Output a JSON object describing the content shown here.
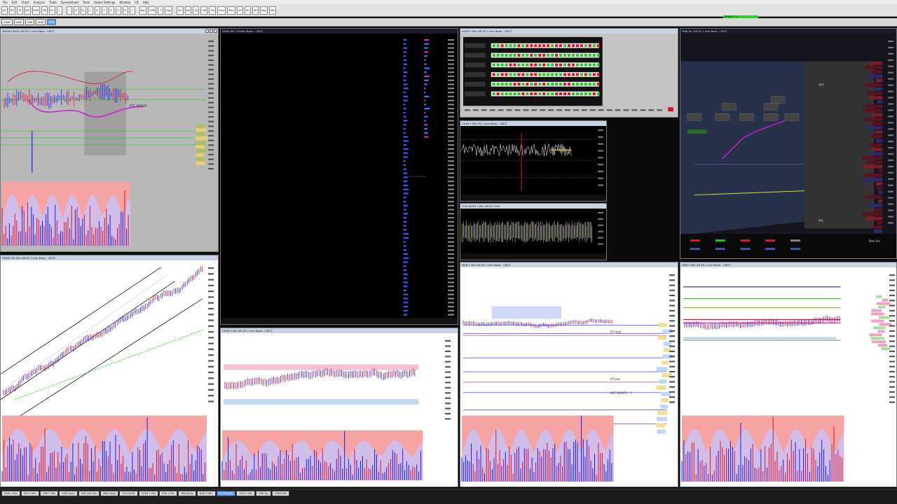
{
  "menu": [
    "File",
    "Edit",
    "Chart",
    "Analysis",
    "Trade",
    "Spreadsheet",
    "Tools",
    "Global Settings",
    "Window",
    "CB",
    "Help"
  ],
  "toolbar_buttons": [
    "SC",
    "DC",
    "TS",
    "CB",
    "DTB",
    "FB",
    "SO",
    "+",
    "-",
    "A",
    "B",
    "C",
    "D",
    "E",
    "F",
    "G",
    "H",
    "I",
    "Rpt",
    "CVW",
    "T",
    "Log",
    "3m",
    "5m",
    "1D",
    "1W",
    "1M",
    "15m",
    "30m",
    "1H",
    "2H",
    "4H",
    "Day",
    "Min"
  ],
  "subtabs": [
    "VSX6",
    "VIX6",
    "YM6",
    "NQ6",
    "ES6"
  ],
  "active_subtab": "ES6",
  "windows": [
    {
      "id": "w1",
      "title": "SNM#3 Daily  #8  ES 1-min Base - CBOT"
    },
    {
      "id": "w2",
      "title": "VSX6 #8 1-Profile  Base - CBOT"
    },
    {
      "id": "w3",
      "title": "VSX6 5 Min  #6  ES 1-min Base - CBOT"
    },
    {
      "id": "w4",
      "title": "YM6 Qtr  #8  ES 1-min Base - CBOT"
    },
    {
      "id": "w5",
      "title": "VXX6 5 Min  ES 1-min Base - CBOT"
    },
    {
      "id": "w6",
      "title": "TICK NYSE  1 Min  #8  ES  TICK"
    },
    {
      "id": "w7",
      "title": "VSX6 200 Min  #8  ES 1-min Base - CBOT"
    },
    {
      "id": "w8",
      "title": "VSX6 5 Min  #8  ES 1-min Base - CBOT"
    },
    {
      "id": "w9",
      "title": "NQ6 1 Min  #8  ES 1-min Base - CBOT"
    },
    {
      "id": "w10",
      "title": "YM6 5 Min  #8  ES 1-min Base - CBOT"
    }
  ],
  "levels": {
    "poc": "POC 440448",
    "vp_high": "VP High",
    "vp_low": "VP Low",
    "poc_month": "POC MONTH - 1",
    "val": "VAL",
    "vah": "VAH",
    "total_vol": "Total Vol"
  },
  "status": "6546 0 7 1",
  "taskbar": [
    "NQ6 1 Min",
    "ES6 5 Min",
    "YM6 5 Min",
    "VIX6 Daily",
    "ES6 200 Min",
    "NQ6 Daily",
    "TICK NYSE",
    "VSX6 1 Min",
    "ES6 1 Min",
    "YM6 Daily",
    "NQ6 5 Min",
    "VSX6 Daily",
    "TICK 1 Min",
    "ES6 Qtr",
    "VSX6 Min"
  ],
  "active_task": "VSX6 Daily",
  "colors": {
    "bg": "#0b0b0b",
    "up": "#1a1aff",
    "down": "#e0102a",
    "green": "#22cc22",
    "magenta": "#d020d0"
  }
}
